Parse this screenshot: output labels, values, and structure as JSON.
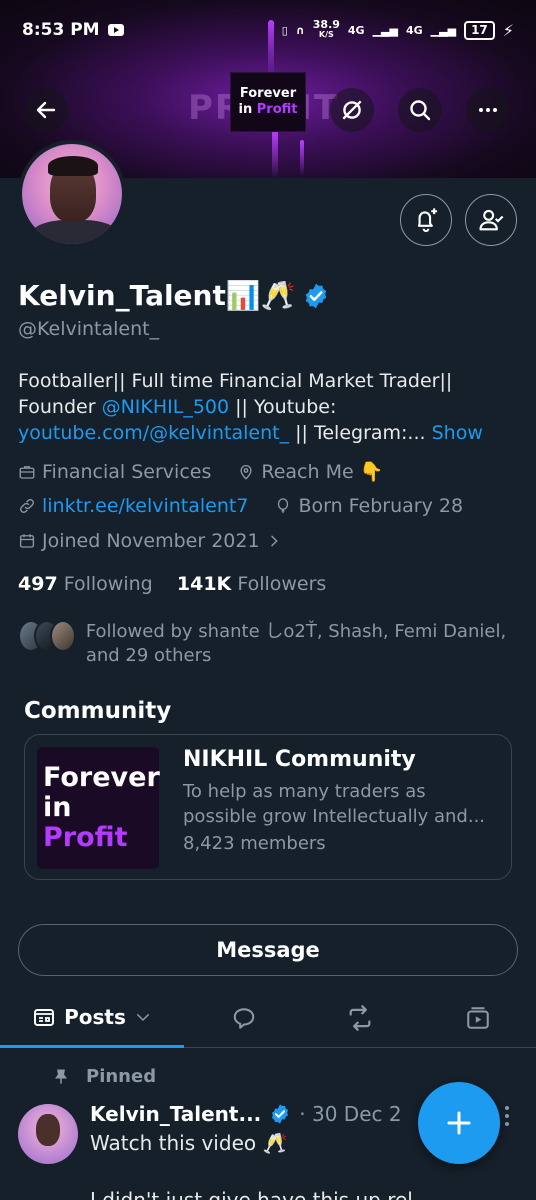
{
  "status": {
    "time": "8:53 PM",
    "speed": "38.9",
    "speed_unit": "K/S",
    "net1": "4G",
    "net2": "4G",
    "battery": "17"
  },
  "banner": {
    "bigword": "PROFIT",
    "logo_line1": "Forever",
    "logo_line2a": "in",
    "logo_line2b": "Profit"
  },
  "profile": {
    "name": "Kelvin_Talent📊🥂",
    "handle": "@Kelvintalent_",
    "bio_1": "Footballer|| Full time Financial Market Trader|| Founder ",
    "bio_mention": "@NIKHIL_500",
    "bio_2": " || Youtube: ",
    "bio_link": "youtube.com/@kelvintalent_",
    "bio_3": " || Telegram:...",
    "bio_show": "Show",
    "category": "Financial Services",
    "location": "Reach Me 👇",
    "website": "linktr.ee/kelvintalent7",
    "born": "Born February 28",
    "joined": "Joined November 2021",
    "following_count": "497",
    "following_label": "Following",
    "followers_count": "141K",
    "followers_label": "Followers",
    "followed_by": "Followed by shante しo2Ť, Shash, Femi Daniel, and 29 others"
  },
  "community": {
    "heading": "Community",
    "title": "NIKHIL Community",
    "description": "To help as many traders as possible grow Intellectually and...",
    "members": "8,423 members",
    "logo_line1": "Forever",
    "logo_line2a": "in",
    "logo_line2b": "Profit"
  },
  "actions": {
    "message": "Message"
  },
  "tabs": {
    "posts": "Posts"
  },
  "post": {
    "pinned_label": "Pinned",
    "author": "Kelvin_Talent...",
    "date": "· 30 Dec 2",
    "text": "Watch this video 🥂",
    "text2": "I didn't just give have this up rel..."
  },
  "colors": {
    "accent": "#1d9bf0",
    "background": "#15202b",
    "secondary_text": "#8b98a5",
    "brand_purple": "#b23bff"
  }
}
